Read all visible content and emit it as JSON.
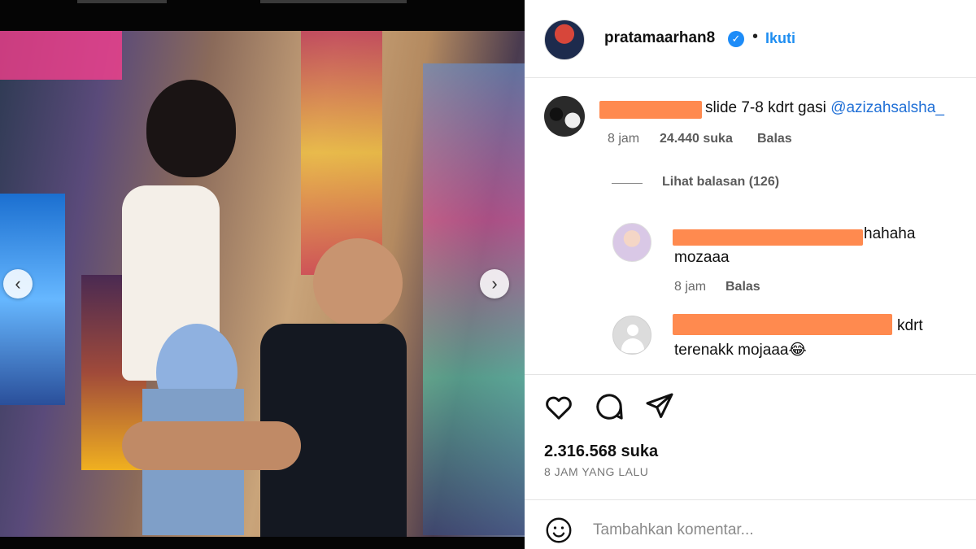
{
  "post": {
    "username": "pratamaarhan8",
    "follow_label": "Ikuti",
    "separator": "•",
    "verified_icon": "verified-badge-icon",
    "slides": {
      "total": 10,
      "active_index": 6
    }
  },
  "comments": [
    {
      "text": "slide 7-8 kdrt gasi",
      "mention": "@azizahsalsha_",
      "time": "8 jam",
      "likes": "24.440 suka",
      "reply_label": "Balas",
      "view_replies": "Lihat balasan (126)"
    },
    {
      "text": "hahaha",
      "text_line2": "mozaaa",
      "time": "8 jam",
      "reply_label": "Balas"
    },
    {
      "text": "kdrt",
      "text_line2": "terenakk mojaaa😂"
    }
  ],
  "actions": {
    "like_icon": "heart-icon",
    "comment_icon": "comment-icon",
    "share_icon": "send-icon"
  },
  "stats": {
    "likes": "2.316.568 suka",
    "posted": "8 JAM YANG LALU"
  },
  "composer": {
    "emoji_icon": "emoji-icon",
    "placeholder": "Tambahkan komentar..."
  },
  "colors": {
    "link_blue": "#1f8ef1",
    "redaction_orange": "#ff8a4f"
  }
}
